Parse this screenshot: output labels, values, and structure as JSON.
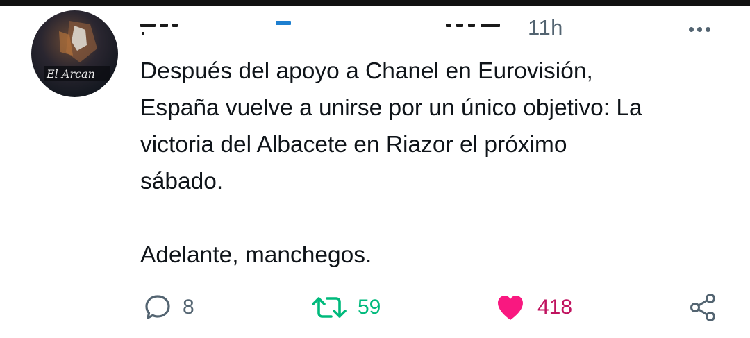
{
  "tweet": {
    "timestamp": "11h",
    "text": "Después del apoyo a Chanel en Eurovisión,\nEspaña vuelve a unirse por un único objetivo: La\nvictoria del Albacete en Riazor el próximo\nsábado.\n\nAdelante, manchegos.",
    "avatar_label": "El Arcan"
  },
  "actions": {
    "reply_count": "8",
    "retweet_count": "59",
    "like_count": "418"
  },
  "colors": {
    "like": "#f91880",
    "retweet": "#00ba7c",
    "muted": "#536471",
    "text": "#0f1419"
  },
  "icons": {
    "reply": "reply-icon",
    "retweet": "retweet-icon",
    "like": "heart-icon",
    "share": "share-icon",
    "more": "more-options-icon"
  }
}
